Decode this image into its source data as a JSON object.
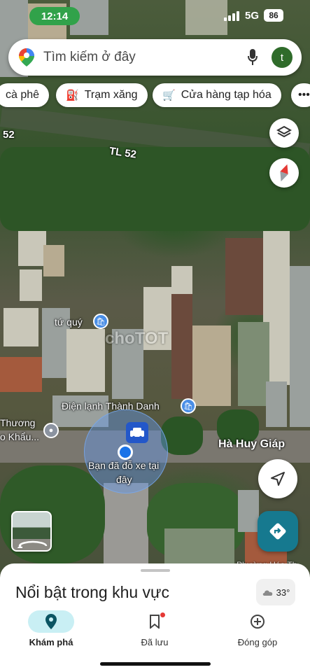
{
  "status_bar": {
    "time": "12:14",
    "network": "5G",
    "battery": "86"
  },
  "search": {
    "placeholder": "Tìm kiếm ở đây",
    "profile_initial": "t"
  },
  "chips": [
    {
      "label": "cà phê",
      "icon": "coffee-icon"
    },
    {
      "label": "Trạm xăng",
      "icon": "gas-station-icon"
    },
    {
      "label": "Cửa hàng tạp hóa",
      "icon": "cart-icon"
    },
    {
      "label": "•••",
      "icon": "more-icon"
    }
  ],
  "map": {
    "road_label_1": "52",
    "road_label_2": "TL 52",
    "poi_1": "tứ quý",
    "poi_2": "Điện lạnh Thành Danh",
    "poi_3_line1": "Thương",
    "poi_3_line2": "o Khẩu...",
    "street": "Hà Huy Giáp",
    "parked_line1": "Bạn đã đỗ xe tại",
    "parked_line2": "đây",
    "watermark": "choTOT",
    "bottom_label": "Phường Hóa Th..."
  },
  "sheet": {
    "title": "Nổi bật trong khu vực",
    "temperature": "33°"
  },
  "nav": {
    "items": [
      {
        "label": "Khám phá",
        "icon": "explore-pin-icon",
        "active": true
      },
      {
        "label": "Đã lưu",
        "icon": "bookmark-icon",
        "active": false
      },
      {
        "label": "Đóng góp",
        "icon": "add-circle-icon",
        "active": false
      }
    ]
  },
  "colors": {
    "accent": "#16798f",
    "nav_active": "#c9eff4",
    "location": "#1a73e8",
    "time_pill": "#31a24a"
  }
}
